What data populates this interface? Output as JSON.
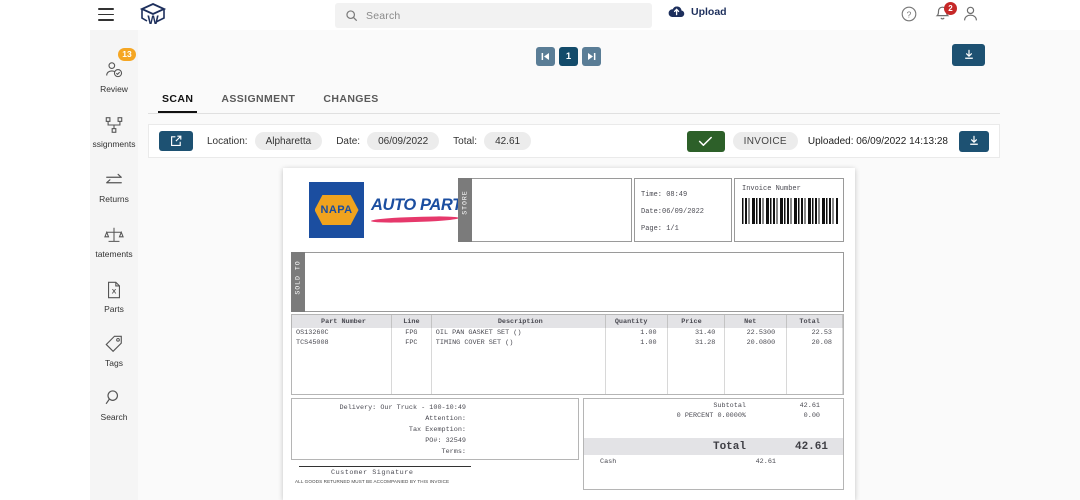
{
  "topbar": {
    "menu_icon": "hamburger-icon",
    "logo_icon": "app-cube-logo",
    "search": {
      "placeholder": "Search",
      "value": "",
      "icon": "search-icon"
    },
    "upload": {
      "label": "Upload",
      "icon": "cloud-upload-icon"
    },
    "help_icon": "help-circle-icon",
    "bell_icon": "bell-icon",
    "bell_badge": "2",
    "user_icon": "user-avatar-icon"
  },
  "sidebar": {
    "badge": "13",
    "items": [
      {
        "label": "Review",
        "icon": "person-check-icon"
      },
      {
        "label": "ssignments",
        "icon": "assignment-node-icon"
      },
      {
        "label": "Returns",
        "icon": "return-arrows-icon"
      },
      {
        "label": "tatements",
        "icon": "scales-icon"
      },
      {
        "label": "Parts",
        "icon": "file-x-icon"
      },
      {
        "label": "Tags",
        "icon": "tag-icon"
      },
      {
        "label": "Search",
        "icon": "search-icon"
      }
    ]
  },
  "pager": {
    "first_icon": "first-page-icon",
    "current_page": "1",
    "next_icon": "next-page-icon",
    "download_icon": "download-icon"
  },
  "tabs": [
    {
      "label": "SCAN",
      "active": true
    },
    {
      "label": "ASSIGNMENT",
      "active": false
    },
    {
      "label": "CHANGES",
      "active": false
    }
  ],
  "infobar": {
    "edit_icon": "edit-square-icon",
    "location_label": "Location:",
    "location_value": "Alpharetta",
    "date_label": "Date:",
    "date_value": "06/09/2022",
    "total_label": "Total:",
    "total_value": "42.61",
    "approve_icon": "check-icon",
    "doc_type": "INVOICE",
    "uploaded": "Uploaded: 06/09/2022 14:13:28",
    "download_icon": "download-icon"
  },
  "document": {
    "brand_name": "NAPA",
    "brand_sub": "AUTO PARTS",
    "store_tab": "STORE",
    "soldto_tab": "SOLD TO",
    "meta": {
      "time": "Time: 08:49",
      "date": "Date:06/09/2022",
      "page": "Page:   1/1"
    },
    "invoice_number_label": "Invoice Number",
    "table": {
      "headers": [
        "Part Number",
        "Line",
        "Description",
        "Quantity",
        "Price",
        "Net",
        "Total"
      ],
      "rows": [
        {
          "part": "OS13260C",
          "line": "FPG",
          "desc": "OIL PAN GASKET SET ()",
          "qty": "1.00",
          "price": "31.40",
          "net": "22.5300",
          "total": "22.53"
        },
        {
          "part": "TCS45008",
          "line": "FPC",
          "desc": "TIMING COVER SET ()",
          "qty": "1.00",
          "price": "31.28",
          "net": "20.0800",
          "total": "20.08"
        }
      ]
    },
    "delivery": {
      "line1": "Delivery: Our Truck - 100-10:49",
      "line2": "Attention:",
      "line3": "Tax Exemption:",
      "line4": "PO#: 32549",
      "line5": "Terms:"
    },
    "signature_label": "Customer Signature",
    "signature_fine": "ALL GOODS RETURNED MUST BE ACCOMPANIED BY THIS INVOICE",
    "totals": {
      "subtotal_label": "Subtotal",
      "subtotal_value": "42.61",
      "percent_label": "0 PERCENT 0.0000%",
      "percent_value": "0.00",
      "total_label": "Total",
      "total_value": "42.61",
      "cash_label": "Cash",
      "cash_value": "42.61"
    }
  },
  "colors": {
    "navy": "#1d5172",
    "navy_dark": "#134b6a",
    "steel": "#5a7d96",
    "green": "#2d6029",
    "orange": "#f5a623",
    "red": "#c62828",
    "napa_blue": "#1b4ea0",
    "napa_gold": "#f0a31e"
  }
}
